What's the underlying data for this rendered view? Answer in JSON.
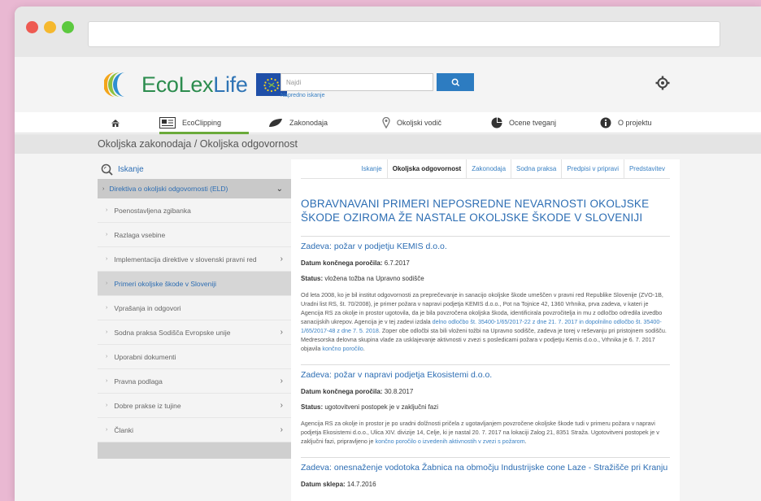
{
  "header": {
    "logo": {
      "eco": "EcoLex",
      "life": "Life"
    },
    "search": {
      "placeholder": "Najdi",
      "advanced_link": "Napredno iskanje"
    }
  },
  "nav": {
    "items": [
      {
        "label": "",
        "icon": "home-icon"
      },
      {
        "label": "EcoClipping",
        "icon": "clipping-icon"
      },
      {
        "label": "Zakonodaja",
        "icon": "leaf-icon"
      },
      {
        "label": "Okoljski vodič",
        "icon": "location-pin-icon"
      },
      {
        "label": "Ocene tveganj",
        "icon": "pie-chart-icon"
      },
      {
        "label": "O projektu",
        "icon": "info-icon"
      }
    ],
    "colors": {
      "ecoclipping": "#6aaa3a",
      "zakonodaja": "#2f74b5",
      "okoljski": "#2f74b5",
      "ocene": "#2f74b5",
      "projektu": "#555555"
    }
  },
  "breadcrumb": "Okoljska zakonodaja / Okoljska odgovornost",
  "sidebar": {
    "search_label": "Iskanje",
    "section": "Direktiva o okoljski odgovornosti (ELD)",
    "items": [
      {
        "label": "Poenostavljena zgibanka",
        "chevron": false,
        "active": false
      },
      {
        "label": "Razlaga vsebine",
        "chevron": false,
        "active": false
      },
      {
        "label": "Implementacija direktive v slovenski pravni red",
        "chevron": true,
        "active": false
      },
      {
        "label": "Primeri okoljske škode v Sloveniji",
        "chevron": false,
        "active": true
      },
      {
        "label": "Vprašanja in odgovori",
        "chevron": false,
        "active": false
      },
      {
        "label": "Sodna praksa Sodišča Evropske unije",
        "chevron": true,
        "active": false
      },
      {
        "label": "Uporabni dokumenti",
        "chevron": false,
        "active": false
      },
      {
        "label": "Pravna podlaga",
        "chevron": true,
        "active": false
      },
      {
        "label": "Dobre prakse iz tujine",
        "chevron": true,
        "active": false
      },
      {
        "label": "Članki",
        "chevron": true,
        "active": false
      }
    ]
  },
  "tabs": [
    {
      "label": "Iskanje",
      "active": false
    },
    {
      "label": "Okoljska odgovornost",
      "active": true
    },
    {
      "label": "Zakonodaja",
      "active": false
    },
    {
      "label": "Sodna praksa",
      "active": false
    },
    {
      "label": "Predpisi v pripravi",
      "active": false
    },
    {
      "label": "Predstavitev",
      "active": false
    }
  ],
  "main": {
    "title": "OBRAVNAVANI PRIMERI NEPOSREDNE NEVARNOSTI OKOLJSKE ŠKODE OZIROMA ŽE NASTALE OKOLJSKE ŠKODE V SLOVENIJI",
    "cases": [
      {
        "title": "Zadeva: požar v podjetju KEMIS d.o.o.",
        "date_label": "Datum končnega poročila:",
        "date": "6.7.2017",
        "status_label": "Status:",
        "status": "vložena tožba na Upravno sodišče",
        "text_parts": [
          {
            "t": "Od leta 2008, ko je bil institut odgovornosti za preprečevanje in sanacijo okoljske škode umeščen v pravni red Republike Slovenije (ZVO-1B, Uradni list RS, št. 70/2008), je primer požara v napravi podjetja KEMIS d.o.o., Pot na Tojnice 42, 1360 Vrhnika, prva zadeva, v kateri je Agencija RS za okolje in prostor ugotovila, da je bila povzročena okoljska škoda, identificirala povzročitelja in mu z odločbo odredila izvedbo sanacijskih ukrepov. Agencija je v tej zadevi izdala ",
            "link": false
          },
          {
            "t": "delno odločbo št. 35400-1/65/2017-22 z dne 21. 7. 2017 in dopolnilno odločbo št. 35400-1/65/2017-48 z dne 7. 5. 2018",
            "link": true
          },
          {
            "t": ". Zoper obe odločbi sta bili vloženi tožbi na Upravno sodišče, zadeva je torej v reševanju pri pristojnem sodišču. Medresorska delovna skupina vlade za usklajevanje aktivnosti v zvezi s posledicami požara v podjetju Kemis d.o.o., Vrhnika je 6. 7. 2017 objavila ",
            "link": false
          },
          {
            "t": "končno poročilo",
            "link": true
          },
          {
            "t": ".",
            "link": false
          }
        ]
      },
      {
        "title": "Zadeva: požar v napravi podjetja Ekosistemi d.o.o.",
        "date_label": "Datum končnega poročila:",
        "date": "30.8.2017",
        "status_label": "Status:",
        "status": "ugotovitveni postopek je v zaključni fazi",
        "text_parts": [
          {
            "t": "Agencija RS za okolje in prostor je po uradni dolžnosti pričela z ugotavljanjem povzročene okoljske škode tudi v primeru požara v napravi podjetja Ekosistemi d.o.o., Ulica XIV. divizije 14, Celje, ki je nastal 20. 7. 2017 na lokaciji Zalog 21, 8351 Straža. Ugotovitveni postopek je v zaključni fazi, pripravljeno je ",
            "link": false
          },
          {
            "t": "končno poročilo o izvedenih aktivnostih v zvezi s požarom",
            "link": true
          },
          {
            "t": ".",
            "link": false
          }
        ]
      },
      {
        "title": "Zadeva: onesnaženje vodotoka Žabnica na območju Industrijske cone Laze - Stražišče pri Kranju",
        "date_label": "Datum sklepa:",
        "date": "14.7.2016",
        "status_label": "",
        "status": "",
        "text_parts": []
      }
    ]
  }
}
